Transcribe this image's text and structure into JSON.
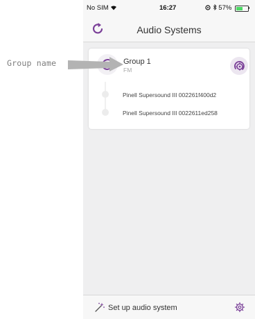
{
  "annotation": {
    "label": "Group name"
  },
  "status_bar": {
    "carrier": "No SIM",
    "wifi_icon": "wifi-icon",
    "time": "16:27",
    "battery_percent": "57%",
    "battery_level": 0.57
  },
  "nav": {
    "title": "Audio Systems",
    "refresh_icon": "refresh-icon"
  },
  "group": {
    "name": "Group 1",
    "source": "FM",
    "icon": "group-sync-icon",
    "settings_icon": "group-settings-icon",
    "speakers": [
      {
        "name": "Pinell Supersound III 002261f400d2"
      },
      {
        "name": "Pinell Supersound III 0022611ed258"
      }
    ]
  },
  "bottom": {
    "setup_label": "Set up audio system",
    "wand_icon": "magic-wand-icon",
    "settings_icon": "gear-icon"
  },
  "colors": {
    "accent": "#7a3f98",
    "background": "#efeff0",
    "bar": "#f7f7f7"
  }
}
